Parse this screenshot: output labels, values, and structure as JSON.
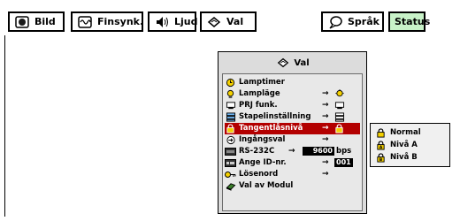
{
  "toolbar": {
    "tabs": [
      {
        "label": "Bild",
        "icon": "picture-icon"
      },
      {
        "label": "Finsynk.",
        "icon": "sync-icon"
      },
      {
        "label": "Ljud",
        "icon": "speaker-icon"
      },
      {
        "label": "Val",
        "icon": "options-icon"
      },
      {
        "label": "Språk",
        "icon": "speech-bubble-icon"
      },
      {
        "label": "Status",
        "icon": null,
        "active": true
      }
    ]
  },
  "dialog": {
    "title": "Val",
    "items": [
      {
        "label": "Lamptimer",
        "icon": "lamp-timer-icon"
      },
      {
        "label": "Lampläge",
        "icon": "lamp-mode-icon",
        "arrow": "→"
      },
      {
        "label": "PRJ funk.",
        "icon": "projector-icon",
        "arrow": "→"
      },
      {
        "label": "Stapelinställning",
        "icon": "stack-icon",
        "arrow": "→"
      },
      {
        "label": "Tangentlåsnivå",
        "icon": "lock-icon",
        "arrow": "→",
        "selected": true
      },
      {
        "label": "Ingångsval",
        "icon": "input-icon",
        "arrow": "→"
      },
      {
        "label": "RS-232C",
        "icon": "rs232-icon",
        "arrow": "→",
        "value": "9600",
        "unit": "bps"
      },
      {
        "label": "Ange ID-nr.",
        "icon": "id-icon",
        "arrow": "→",
        "value": "001"
      },
      {
        "label": "Lösenord",
        "icon": "key-icon",
        "arrow": "→"
      },
      {
        "label": "Val av Modul",
        "icon": "module-icon"
      }
    ]
  },
  "submenu": {
    "options": [
      {
        "label": "Normal",
        "icon": "lock-icon"
      },
      {
        "label": "Nivå A",
        "icon": "lock-icon"
      },
      {
        "label": "Nivå B",
        "icon": "lock-icon"
      }
    ]
  },
  "colors": {
    "selected_row": "#b30000",
    "status_tab": "#c8f2c8",
    "dialog_bg": "#dcdcdc"
  }
}
